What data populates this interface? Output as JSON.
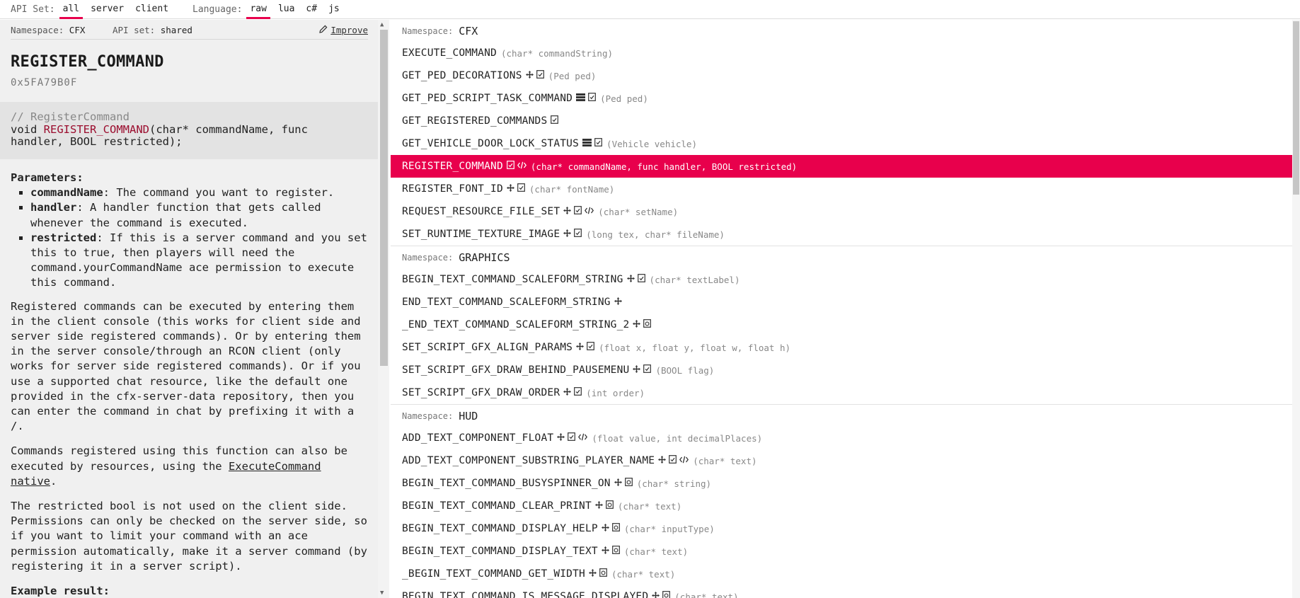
{
  "topbar": {
    "api_set_label": "API Set:",
    "api_options": [
      "all",
      "server",
      "client"
    ],
    "api_active": 0,
    "language_label": "Language:",
    "language_options": [
      "raw",
      "lua",
      "c#",
      "js"
    ],
    "language_active": 0,
    "accent_color": "#e8004c"
  },
  "doc": {
    "namespace_label": "Namespace:",
    "namespace_value": "CFX",
    "apiset_label": "API set:",
    "apiset_value": "shared",
    "improve_label": "Improve",
    "title": "REGISTER_COMMAND",
    "hash": "0x5FA79B0F",
    "signature_comment": "// RegisterCommand",
    "signature_return": "void",
    "signature_name": "REGISTER_COMMAND",
    "signature_params_line1": "(char* commandName, func",
    "signature_params_line2": "handler, BOOL restricted);",
    "parameters_label": "Parameters:",
    "parameters": [
      {
        "name": "commandName",
        "desc": ": The command you want to register."
      },
      {
        "name": "handler",
        "desc": ": A handler function that gets called whenever the command is executed."
      },
      {
        "name": "restricted",
        "desc": ": If this is a server command and you set this to true, then players will need the command.yourCommandName ace permission to execute this command."
      }
    ],
    "para1": "Registered commands can be executed by entering them in the client console (this works for client side and server side registered commands). Or by entering them in the server console/through an RCON client (only works for server side registered commands). Or if you use a supported chat resource, like the default one provided in the cfx-server-data repository, then you can enter the command in chat by prefixing it with a /.",
    "para2_prefix": "Commands registered using this function can also be executed by resources, using the ",
    "para2_link": "ExecuteCommand native",
    "para2_suffix": ".",
    "para3": "The restricted bool is not used on the client side. Permissions can only be checked on the server side, so if you want to limit your command with an ace permission automatically, make it a server command (by registering it in a server script).",
    "example_label": "Example result:"
  },
  "list": {
    "namespace_label": "Namespace:",
    "sections": [
      {
        "name": "CFX",
        "natives": [
          {
            "name": "EXECUTE_COMMAND",
            "icons": [],
            "args": "(char* commandString)"
          },
          {
            "name": "GET_PED_DECORATIONS",
            "icons": [
              "move",
              "doc"
            ],
            "args": "(Ped ped)"
          },
          {
            "name": "GET_PED_SCRIPT_TASK_COMMAND",
            "icons": [
              "server",
              "doc"
            ],
            "args": "(Ped ped)"
          },
          {
            "name": "GET_REGISTERED_COMMANDS",
            "icons": [
              "doc"
            ],
            "args": ""
          },
          {
            "name": "GET_VEHICLE_DOOR_LOCK_STATUS",
            "icons": [
              "server",
              "doc"
            ],
            "args": "(Vehicle vehicle)"
          },
          {
            "name": "REGISTER_COMMAND",
            "icons": [
              "doc",
              "code"
            ],
            "args": "(char* commandName, func handler, BOOL restricted)",
            "selected": true
          },
          {
            "name": "REGISTER_FONT_ID",
            "icons": [
              "move",
              "doc"
            ],
            "args": "(char* fontName)"
          },
          {
            "name": "REQUEST_RESOURCE_FILE_SET",
            "icons": [
              "move",
              "doc",
              "code"
            ],
            "args": "(char* setName)"
          },
          {
            "name": "SET_RUNTIME_TEXTURE_IMAGE",
            "icons": [
              "move",
              "doc"
            ],
            "args": "(long tex, char* fileName)"
          }
        ]
      },
      {
        "name": "GRAPHICS",
        "natives": [
          {
            "name": "BEGIN_TEXT_COMMAND_SCALEFORM_STRING",
            "icons": [
              "move",
              "doc"
            ],
            "args": "(char* textLabel)"
          },
          {
            "name": "END_TEXT_COMMAND_SCALEFORM_STRING",
            "icons": [
              "move"
            ],
            "args": ""
          },
          {
            "name": "_END_TEXT_COMMAND_SCALEFORM_STRING_2",
            "icons": [
              "move",
              "undoc"
            ],
            "args": ""
          },
          {
            "name": "SET_SCRIPT_GFX_ALIGN_PARAMS",
            "icons": [
              "move",
              "doc"
            ],
            "args": "(float x, float y, float w, float h)"
          },
          {
            "name": "SET_SCRIPT_GFX_DRAW_BEHIND_PAUSEMENU",
            "icons": [
              "move",
              "doc"
            ],
            "args": "(BOOL flag)"
          },
          {
            "name": "SET_SCRIPT_GFX_DRAW_ORDER",
            "icons": [
              "move",
              "doc"
            ],
            "args": "(int order)"
          }
        ]
      },
      {
        "name": "HUD",
        "natives": [
          {
            "name": "ADD_TEXT_COMPONENT_FLOAT",
            "icons": [
              "move",
              "doc",
              "code"
            ],
            "args": "(float value, int decimalPlaces)"
          },
          {
            "name": "ADD_TEXT_COMPONENT_SUBSTRING_PLAYER_NAME",
            "icons": [
              "move",
              "doc",
              "code"
            ],
            "args": "(char* text)"
          },
          {
            "name": "BEGIN_TEXT_COMMAND_BUSYSPINNER_ON",
            "icons": [
              "move",
              "undoc"
            ],
            "args": "(char* string)"
          },
          {
            "name": "BEGIN_TEXT_COMMAND_CLEAR_PRINT",
            "icons": [
              "move",
              "undoc"
            ],
            "args": "(char* text)"
          },
          {
            "name": "BEGIN_TEXT_COMMAND_DISPLAY_HELP",
            "icons": [
              "move",
              "undoc"
            ],
            "args": "(char* inputType)"
          },
          {
            "name": "BEGIN_TEXT_COMMAND_DISPLAY_TEXT",
            "icons": [
              "move",
              "undoc"
            ],
            "args": "(char* text)"
          },
          {
            "name": "_BEGIN_TEXT_COMMAND_GET_WIDTH",
            "icons": [
              "move",
              "undoc"
            ],
            "args": "(char* text)"
          },
          {
            "name": "BEGIN_TEXT_COMMAND_IS_MESSAGE_DISPLAYED",
            "icons": [
              "move",
              "undoc"
            ],
            "args": "(char* text)"
          }
        ]
      }
    ]
  }
}
